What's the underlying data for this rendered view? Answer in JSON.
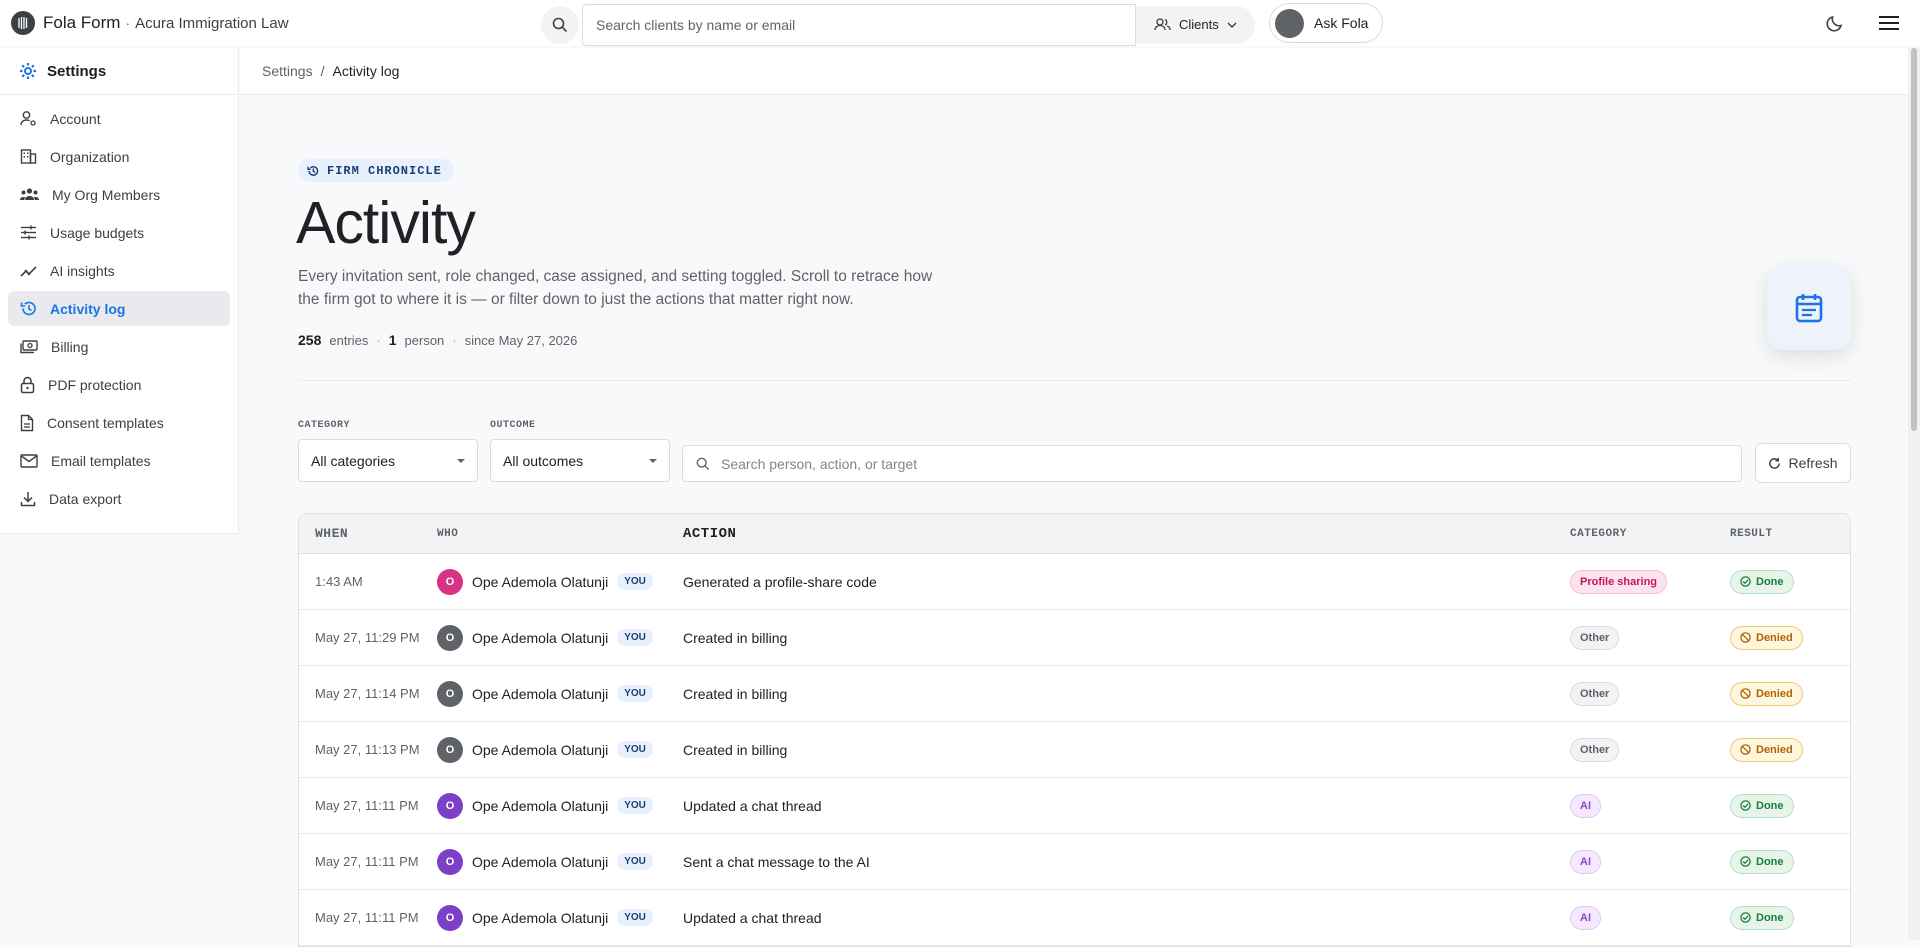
{
  "topbar": {
    "brand": "Fola Form",
    "separator": "·",
    "org": "Acura Immigration Law",
    "search_placeholder": "Search clients by name or email",
    "clients_label": "Clients",
    "ask_label": "Ask Fola"
  },
  "sidebar": {
    "title": "Settings",
    "items": [
      {
        "label": "Account",
        "icon": "account-icon"
      },
      {
        "label": "Organization",
        "icon": "organization-icon"
      },
      {
        "label": "My Org Members",
        "icon": "members-icon"
      },
      {
        "label": "Usage budgets",
        "icon": "sliders-icon"
      },
      {
        "label": "AI insights",
        "icon": "insights-icon"
      },
      {
        "label": "Activity log",
        "icon": "history-icon",
        "active": true
      },
      {
        "label": "Billing",
        "icon": "billing-icon"
      },
      {
        "label": "PDF protection",
        "icon": "lock-icon"
      },
      {
        "label": "Consent templates",
        "icon": "document-icon"
      },
      {
        "label": "Email templates",
        "icon": "mail-icon"
      },
      {
        "label": "Data export",
        "icon": "download-icon"
      }
    ]
  },
  "breadcrumb": {
    "parent": "Settings",
    "sep": "/",
    "current": "Activity log"
  },
  "hero": {
    "pill": "FIRM CHRONICLE",
    "title": "Activity",
    "description": "Every invitation sent, role changed, case assigned, and setting toggled. Scroll to retrace how the firm got to where it is — or filter down to just the actions that matter right now.",
    "entries_count": "258",
    "entries_label": "entries",
    "people_count": "1",
    "people_label": "person",
    "since": "since May 27, 2026",
    "dot": "·"
  },
  "filters": {
    "category_label": "CATEGORY",
    "category_value": "All categories",
    "outcome_label": "OUTCOME",
    "outcome_value": "All outcomes",
    "search_placeholder": "Search person, action, or target",
    "refresh_label": "Refresh"
  },
  "table": {
    "headers": {
      "when": "WHEN",
      "who": "WHO",
      "action": "ACTION",
      "category": "CATEGORY",
      "result": "RESULT"
    },
    "rows": [
      {
        "when": "1:43 AM",
        "initial": "O",
        "avatar_color": "#d63384",
        "who": "Ope Ademola Olatunji",
        "you": "YOU",
        "action": "Generated a profile-share code",
        "category": "Profile sharing",
        "cat_class": "cat-profile",
        "result": "Done",
        "res_class": "res-done"
      },
      {
        "when": "May 27, 11:29 PM",
        "initial": "O",
        "avatar_color": "#5f6368",
        "who": "Ope Ademola Olatunji",
        "you": "YOU",
        "action": "Created in billing",
        "category": "Other",
        "cat_class": "cat-other",
        "result": "Denied",
        "res_class": "res-denied"
      },
      {
        "when": "May 27, 11:14 PM",
        "initial": "O",
        "avatar_color": "#5f6368",
        "who": "Ope Ademola Olatunji",
        "you": "YOU",
        "action": "Created in billing",
        "category": "Other",
        "cat_class": "cat-other",
        "result": "Denied",
        "res_class": "res-denied"
      },
      {
        "when": "May 27, 11:13 PM",
        "initial": "O",
        "avatar_color": "#5f6368",
        "who": "Ope Ademola Olatunji",
        "you": "YOU",
        "action": "Created in billing",
        "category": "Other",
        "cat_class": "cat-other",
        "result": "Denied",
        "res_class": "res-denied"
      },
      {
        "when": "May 27, 11:11 PM",
        "initial": "O",
        "avatar_color": "#7b3fc8",
        "who": "Ope Ademola Olatunji",
        "you": "YOU",
        "action": "Updated a chat thread",
        "category": "AI",
        "cat_class": "cat-ai",
        "result": "Done",
        "res_class": "res-done"
      },
      {
        "when": "May 27, 11:11 PM",
        "initial": "O",
        "avatar_color": "#7b3fc8",
        "who": "Ope Ademola Olatunji",
        "you": "YOU",
        "action": "Sent a chat message to the AI",
        "category": "AI",
        "cat_class": "cat-ai",
        "result": "Done",
        "res_class": "res-done"
      },
      {
        "when": "May 27, 11:11 PM",
        "initial": "O",
        "avatar_color": "#7b3fc8",
        "who": "Ope Ademola Olatunji",
        "you": "YOU",
        "action": "Updated a chat thread",
        "category": "AI",
        "cat_class": "cat-ai",
        "result": "Done",
        "res_class": "res-done"
      }
    ]
  },
  "colors": {
    "accent": "#1a73e8",
    "done": "#188038",
    "denied": "#b06000"
  }
}
